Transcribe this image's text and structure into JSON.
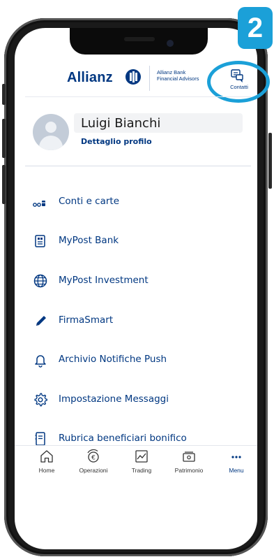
{
  "step_badge": "2",
  "header": {
    "brand": "Allianz",
    "sub_line1": "Allianz Bank",
    "sub_line2": "Financial Advisors",
    "contacts_label": "Contatti"
  },
  "profile": {
    "name": "Luigi Bianchi",
    "detail_link": "Dettaglio profilo"
  },
  "menu": [
    {
      "label": "Conti e carte",
      "icon": "cards-icon"
    },
    {
      "label": "MyPost Bank",
      "icon": "post-bank-icon"
    },
    {
      "label": "MyPost Investment",
      "icon": "globe-icon"
    },
    {
      "label": "FirmaSmart",
      "icon": "pen-icon"
    },
    {
      "label": "Archivio Notifiche Push",
      "icon": "bell-icon"
    },
    {
      "label": "Impostazione Messaggi",
      "icon": "gear-icon"
    },
    {
      "label": "Rubrica beneficiari bonifico",
      "icon": "address-book-icon"
    }
  ],
  "tabs": [
    {
      "label": "Home",
      "icon": "home-icon"
    },
    {
      "label": "Operazioni",
      "icon": "euro-exchange-icon"
    },
    {
      "label": "Trading",
      "icon": "trading-chart-icon"
    },
    {
      "label": "Patrimonio",
      "icon": "wallet-icon"
    },
    {
      "label": "Menu",
      "icon": "more-dots-icon"
    }
  ],
  "colors": {
    "brand_blue": "#003781",
    "highlight": "#1ba0d8"
  }
}
